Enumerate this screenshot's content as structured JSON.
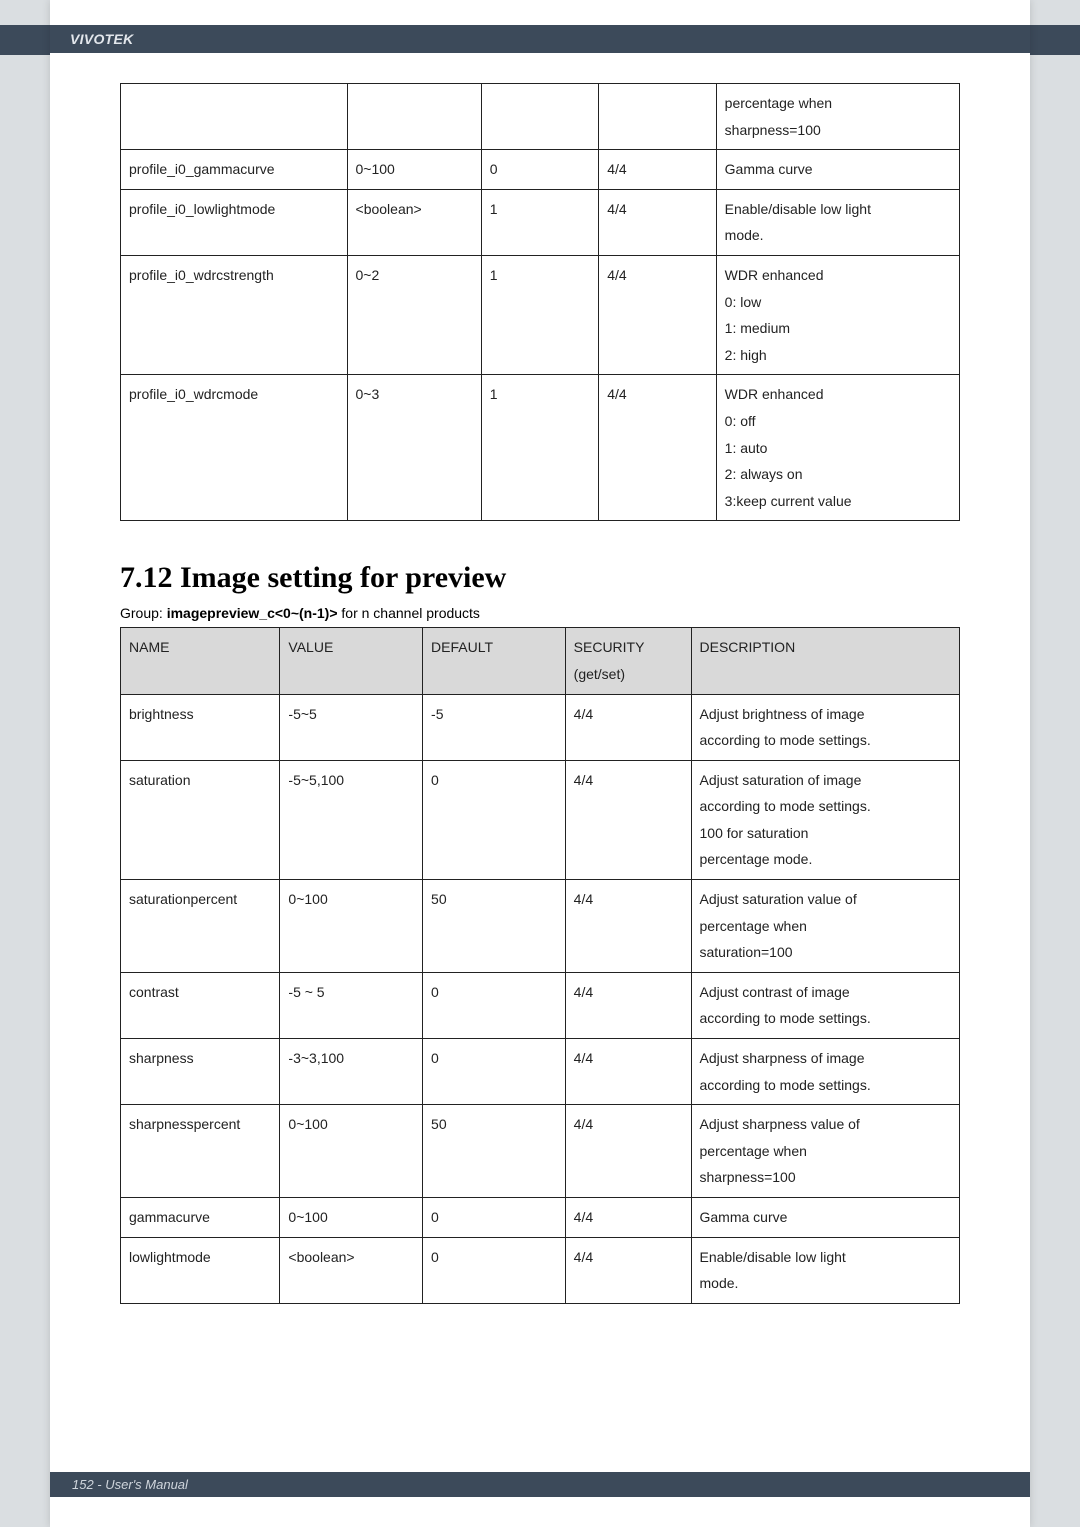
{
  "header": {
    "brand": "VIVOTEK"
  },
  "footer": {
    "text": "152 - User's Manual"
  },
  "table1": {
    "rows": [
      {
        "name": "",
        "value": "",
        "default": "",
        "security": "",
        "description": "percentage when\nsharpness=100"
      },
      {
        "name": "profile_i0_gammacurve",
        "value": "0~100",
        "default": "0",
        "security": "4/4",
        "description": "Gamma curve"
      },
      {
        "name": "profile_i0_lowlightmode",
        "value": "<boolean>",
        "default": "1",
        "security": "4/4",
        "description": "Enable/disable low light\nmode."
      },
      {
        "name": "profile_i0_wdrcstrength",
        "value": "0~2",
        "default": "1",
        "security": "4/4",
        "description": "WDR enhanced\n0: low\n1: medium\n2: high"
      },
      {
        "name": "profile_i0_wdrcmode",
        "value": "0~3",
        "default": "1",
        "security": "4/4",
        "description": "WDR enhanced\n0: off\n1: auto\n2: always on\n3:keep current value"
      }
    ]
  },
  "section": {
    "heading": "7.12 Image setting for preview",
    "group_prefix": "Group: ",
    "group_bold": "imagepreview_c<0~(n-1)>",
    "group_suffix": " for n channel products"
  },
  "table2": {
    "headers": {
      "c1": "NAME",
      "c2": "VALUE",
      "c3": "DEFAULT",
      "c4": "SECURITY\n(get/set)",
      "c5": "DESCRIPTION"
    },
    "rows": [
      {
        "name": "brightness",
        "value": "-5~5",
        "default": "-5",
        "security": "4/4",
        "description": "Adjust brightness of image\naccording to mode settings."
      },
      {
        "name": "saturation",
        "value": "-5~5,100",
        "default": "0",
        "security": "4/4",
        "description": "Adjust saturation of image\naccording to mode settings.\n100 for saturation\npercentage mode."
      },
      {
        "name": "saturationpercent",
        "value": "0~100",
        "default": "50",
        "security": "4/4",
        "description": "Adjust saturation value of\npercentage when\nsaturation=100"
      },
      {
        "name": "contrast",
        "value": "-5 ~ 5",
        "default": "0",
        "security": "4/4",
        "description": "Adjust contrast of image\naccording to mode settings."
      },
      {
        "name": "sharpness",
        "value": "-3~3,100",
        "default": "0",
        "security": "4/4",
        "description": "Adjust sharpness of image\naccording to mode settings."
      },
      {
        "name": "sharpnesspercent",
        "value": "0~100",
        "default": "50",
        "security": "4/4",
        "description": "Adjust sharpness value of\npercentage when\nsharpness=100"
      },
      {
        "name": "gammacurve",
        "value": "0~100",
        "default": "0",
        "security": "4/4",
        "description": "Gamma curve"
      },
      {
        "name": "lowlightmode",
        "value": "<boolean>",
        "default": "0",
        "security": "4/4",
        "description": "Enable/disable low light\nmode."
      }
    ]
  }
}
